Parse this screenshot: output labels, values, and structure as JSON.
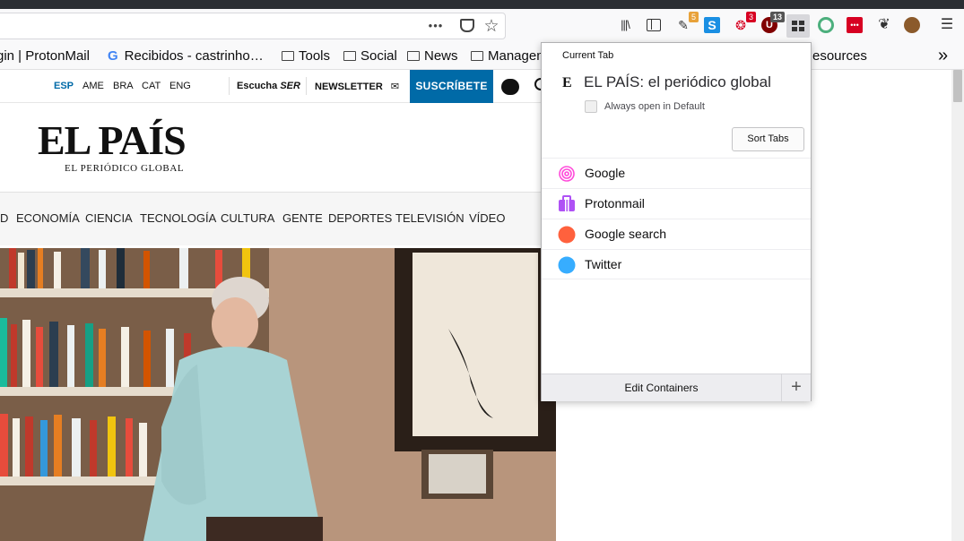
{
  "toolbar": {
    "url_buttons": {
      "more": "•••",
      "pocket": "pocket-icon",
      "star": "☆"
    },
    "icons": [
      {
        "name": "library-icon",
        "glyph": "|||\\"
      },
      {
        "name": "sidebar-icon",
        "glyph": "▯"
      },
      {
        "name": "extension-flag-icon",
        "badge": "5",
        "badge_color": "#e8a23a"
      },
      {
        "name": "s-extension-icon",
        "glyph": "S"
      },
      {
        "name": "extension-red-icon",
        "badge": "3",
        "badge_color": "#d70022"
      },
      {
        "name": "ublock-icon",
        "badge": "13",
        "badge_color": "#555"
      },
      {
        "name": "containers-icon"
      },
      {
        "name": "green-extension-icon"
      },
      {
        "name": "red-dots-icon"
      },
      {
        "name": "foot-icon"
      },
      {
        "name": "cookie-icon"
      },
      {
        "name": "menu-icon",
        "glyph": "☰"
      }
    ]
  },
  "bookmarks": [
    {
      "label": "gin | ProtonMail",
      "type": "page"
    },
    {
      "label": "Recibidos - castrinho…",
      "type": "google"
    },
    {
      "label": "Tools",
      "type": "folder"
    },
    {
      "label": "Social",
      "type": "folder"
    },
    {
      "label": "News",
      "type": "folder"
    },
    {
      "label": "Managem",
      "type": "folder"
    },
    {
      "label": "esources",
      "type": "page"
    }
  ],
  "page": {
    "editions": [
      "ESP",
      "AME",
      "BRA",
      "CAT",
      "ENG"
    ],
    "listen_label": "Escucha",
    "ser_label": "SER",
    "newsletter_label": "NEWSLETTER",
    "subscribe_label": "SUSCRÍBETE",
    "logo": "EL PAÍS",
    "tagline": "EL PERIÓDICO GLOBAL",
    "sections": [
      "D",
      "ECONOMÍA",
      "CIENCIA",
      "TECNOLOGÍA",
      "CULTURA",
      "GENTE",
      "DEPORTES",
      "TELEVISIÓN",
      "VÍDEO"
    ]
  },
  "popup": {
    "header": "Current Tab",
    "tab_favicon": "E",
    "tab_title": "EL PAÍS: el periódico global",
    "always_open_label": "Always open in Default",
    "sort_tabs_label": "Sort Tabs",
    "containers": [
      {
        "name": "Google",
        "icon": "fingerprint-icon",
        "color": "#ff4bda"
      },
      {
        "name": "Protonmail",
        "icon": "briefcase-icon",
        "color": "#af51f5"
      },
      {
        "name": "Google search",
        "icon": "circle-icon",
        "color": "#ff613d"
      },
      {
        "name": "Twitter",
        "icon": "circle-icon",
        "color": "#37adff"
      }
    ],
    "edit_label": "Edit Containers",
    "add_label": "+"
  }
}
